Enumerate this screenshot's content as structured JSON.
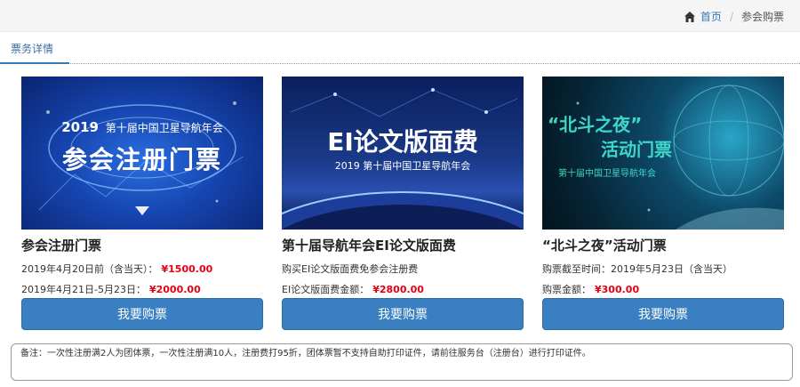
{
  "breadcrumb": {
    "home": "首页",
    "current": "参会购票"
  },
  "tab": {
    "label": "票务详情"
  },
  "cards": [
    {
      "banner": {
        "year": "2019",
        "subtitle": "第十届中国卫星导航年会",
        "headline": "参会注册门票"
      },
      "title": "参会注册门票",
      "lines": [
        {
          "label": "2019年4月20日前（含当天）：",
          "price": "¥1500.00"
        },
        {
          "label": "2019年4月21日-5月23日：",
          "price": "¥2000.00"
        }
      ],
      "button": "我要购票"
    },
    {
      "banner": {
        "headline": "EI论文版面费",
        "subtitle": "2019 第十届中国卫星导航年会"
      },
      "title": "第十届导航年会EI论文版面费",
      "lines": [
        {
          "label": "购买EI论文版面费免参会注册费",
          "price": ""
        },
        {
          "label": "EI论文版面费金额：",
          "price": "¥2800.00"
        }
      ],
      "button": "我要购票"
    },
    {
      "banner": {
        "headline": "“北斗之夜”",
        "headline2": "活动门票",
        "subtitle": "第十届中国卫星导航年会"
      },
      "title": "“北斗之夜”活动门票",
      "lines": [
        {
          "label": "购票截至时间：2019年5月23日（含当天）",
          "price": ""
        },
        {
          "label": "购票金额：",
          "price": "¥300.00"
        }
      ],
      "button": "我要购票"
    }
  ],
  "notice": "备注：一次性注册满2人为团体票，一次性注册满10人，注册费打95折，团体票暂不支持自助打印证件，请前往服务台（注册台）进行打印证件。",
  "colors": {
    "accent": "#337ab7",
    "button": "#3a7fc1",
    "price": "#e60012"
  }
}
